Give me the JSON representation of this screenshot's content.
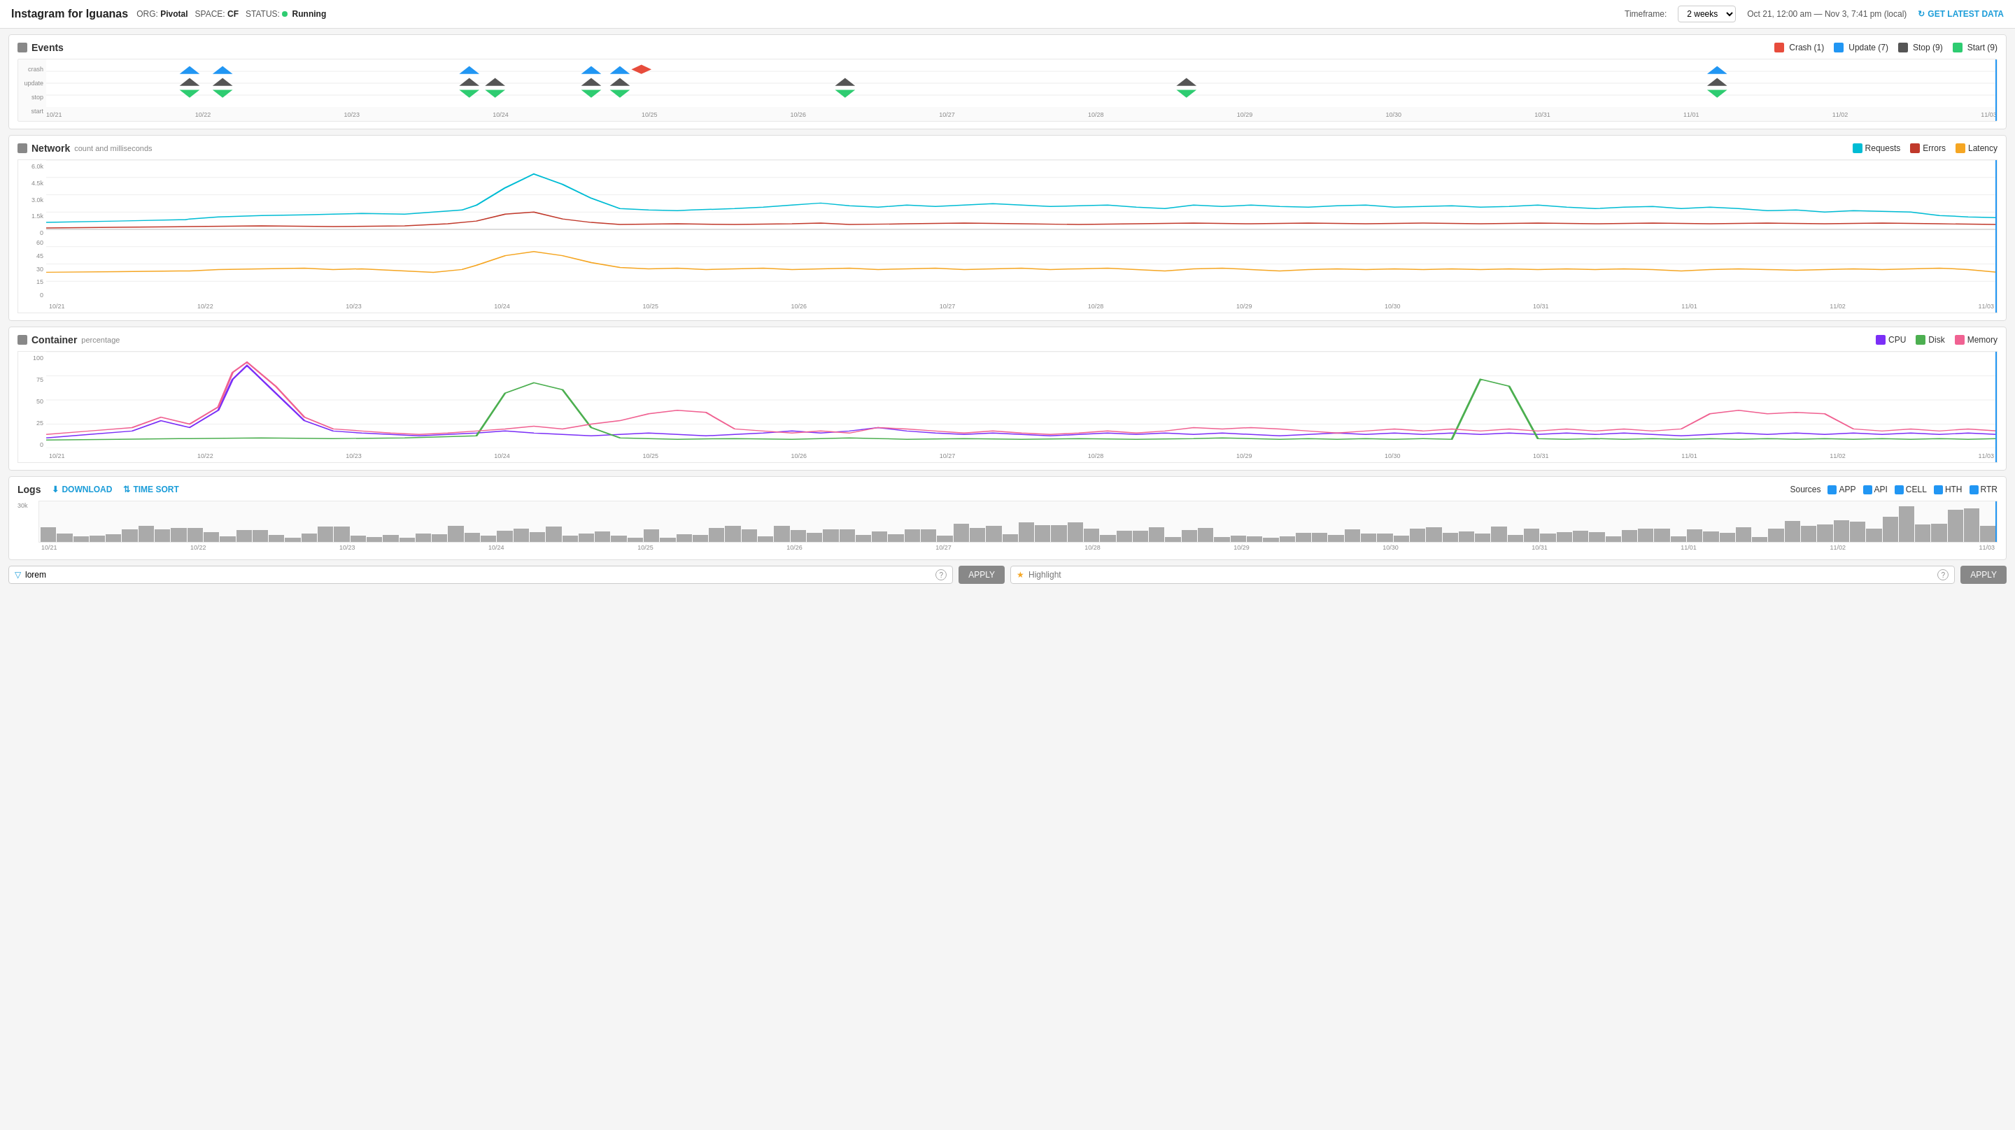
{
  "header": {
    "app_name": "Instagram for Iguanas",
    "org_label": "ORG:",
    "org_value": "Pivotal",
    "space_label": "SPACE:",
    "space_value": "CF",
    "status_label": "STATUS:",
    "status_value": "Running",
    "timeframe_label": "Timeframe:",
    "timeframe_value": "2 weeks",
    "date_range": "Oct 21, 12:00 am — Nov 3, 7:41 pm (local)",
    "get_latest": "GET LATEST DATA"
  },
  "events": {
    "title": "Events",
    "legend": [
      {
        "label": "Crash (1)",
        "color": "#e74c3c"
      },
      {
        "label": "Update (7)",
        "color": "#2196f3"
      },
      {
        "label": "Stop (9)",
        "color": "#555"
      },
      {
        "label": "Start (9)",
        "color": "#2ecc71"
      }
    ],
    "y_labels": [
      "crash",
      "update",
      "stop",
      "start"
    ],
    "x_labels": [
      "10/21",
      "10/22",
      "10/23",
      "10/24",
      "10/25",
      "10/26",
      "10/27",
      "10/28",
      "10/29",
      "10/30",
      "10/31",
      "11/01",
      "11/02",
      "11/03"
    ]
  },
  "network": {
    "title": "Network",
    "subtitle": "count and milliseconds",
    "legend": [
      {
        "label": "Requests",
        "color": "#00bcd4"
      },
      {
        "label": "Errors",
        "color": "#c0392b"
      },
      {
        "label": "Latency",
        "color": "#f5a623"
      }
    ],
    "y_labels_top": [
      "6.0k",
      "4.5k",
      "3.0k",
      "1.5k",
      "0"
    ],
    "y_labels_bottom": [
      "60",
      "45",
      "30",
      "15",
      "0"
    ],
    "x_labels": [
      "10/21",
      "10/22",
      "10/23",
      "10/24",
      "10/25",
      "10/26",
      "10/27",
      "10/28",
      "10/29",
      "10/30",
      "10/31",
      "11/01",
      "11/02",
      "11/03"
    ]
  },
  "container": {
    "title": "Container",
    "subtitle": "percentage",
    "legend": [
      {
        "label": "CPU",
        "color": "#7b2ff7"
      },
      {
        "label": "Disk",
        "color": "#4caf50"
      },
      {
        "label": "Memory",
        "color": "#f06292"
      }
    ],
    "y_labels": [
      "100",
      "75",
      "50",
      "25",
      "0"
    ],
    "x_labels": [
      "10/21",
      "10/22",
      "10/23",
      "10/24",
      "10/25",
      "10/26",
      "10/27",
      "10/28",
      "10/29",
      "10/30",
      "10/31",
      "11/01",
      "11/02",
      "11/03"
    ]
  },
  "logs": {
    "title": "Logs",
    "download_label": "DOWNLOAD",
    "time_sort_label": "TIME SORT",
    "sources_label": "Sources",
    "sources": [
      {
        "label": "APP",
        "color": "#2196f3"
      },
      {
        "label": "API",
        "color": "#2196f3"
      },
      {
        "label": "CELL",
        "color": "#2196f3"
      },
      {
        "label": "HTH",
        "color": "#2196f3"
      },
      {
        "label": "RTR",
        "color": "#2196f3"
      }
    ],
    "y_label": "30k",
    "x_labels": [
      "10/21",
      "10/22",
      "10/23",
      "10/24",
      "10/25",
      "10/26",
      "10/27",
      "10/28",
      "10/29",
      "10/30",
      "10/31",
      "11/01",
      "11/02",
      "11/03"
    ]
  },
  "filter": {
    "placeholder": "lorem",
    "help": "?",
    "apply_label": "APPLY",
    "highlight_placeholder": "Highlight",
    "highlight_apply": "APPLY"
  }
}
